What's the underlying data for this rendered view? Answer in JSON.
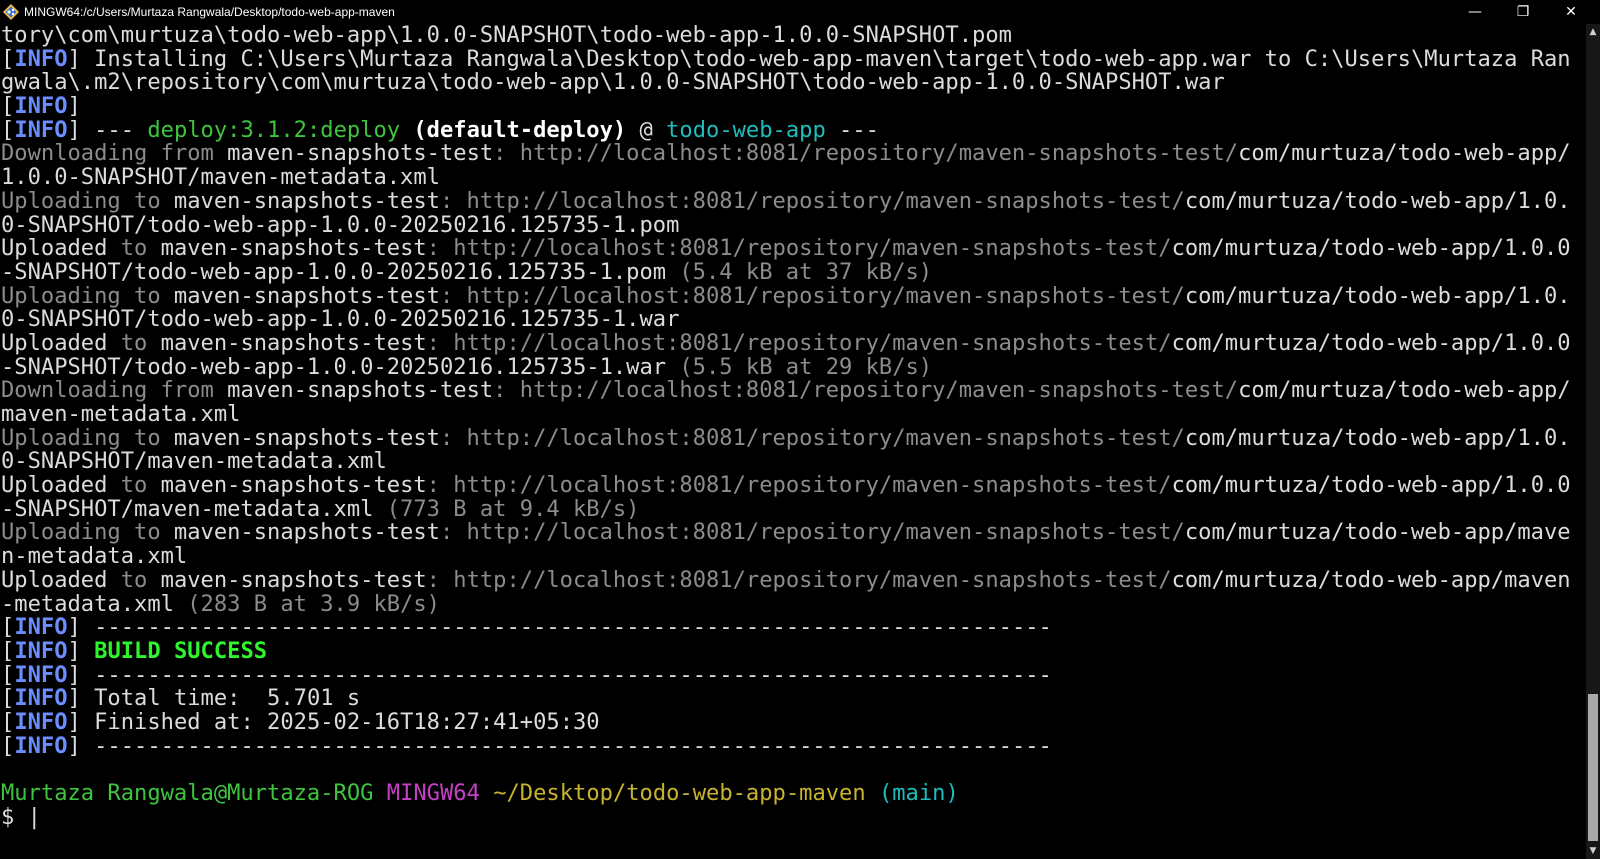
{
  "window": {
    "title": "MINGW64:/c/Users/Murtaza Rangwala/Desktop/todo-web-app-maven",
    "icon": "git-bash-icon",
    "minimize_glyph": "—",
    "maximize_glyph": "❐",
    "close_glyph": "✕"
  },
  "lines": [
    [
      {
        "t": "tory\\com\\murtuza\\todo-web-app\\1.0.0-SNAPSHOT\\todo-web-app-1.0.0-SNAPSHOT.pom",
        "c": "w"
      }
    ],
    [
      {
        "t": "[",
        "c": "w"
      },
      {
        "t": "INFO",
        "c": "b"
      },
      {
        "t": "] Installing C:\\Users\\Murtaza Rangwala\\Desktop\\todo-web-app-maven\\target\\todo-web-app.war to C:\\Users\\Murtaza Ran",
        "c": "w"
      }
    ],
    [
      {
        "t": "gwala\\.m2\\repository\\com\\murtuza\\todo-web-app\\1.0.0-SNAPSHOT\\todo-web-app-1.0.0-SNAPSHOT.war",
        "c": "w"
      }
    ],
    [
      {
        "t": "[",
        "c": "w"
      },
      {
        "t": "INFO",
        "c": "b"
      },
      {
        "t": "]",
        "c": "w"
      }
    ],
    [
      {
        "t": "[",
        "c": "w"
      },
      {
        "t": "INFO",
        "c": "b"
      },
      {
        "t": "] --- ",
        "c": "w"
      },
      {
        "t": "deploy:3.1.2:deploy",
        "c": "grn"
      },
      {
        "t": " (default-deploy)",
        "c": "bw"
      },
      {
        "t": " @ ",
        "c": "w"
      },
      {
        "t": "todo-web-app",
        "c": "cy"
      },
      {
        "t": " ---",
        "c": "w"
      }
    ],
    [
      {
        "t": "Downloading from ",
        "c": "g"
      },
      {
        "t": "maven-snapshots-test",
        "c": "w"
      },
      {
        "t": ": http://localhost:8081/repository/maven-snapshots-test/",
        "c": "g"
      },
      {
        "t": "com/murtuza/todo-web-app/",
        "c": "w"
      }
    ],
    [
      {
        "t": "1.0.0-SNAPSHOT/maven-metadata.xml",
        "c": "w"
      }
    ],
    [
      {
        "t": "Uploading to ",
        "c": "g"
      },
      {
        "t": "maven-snapshots-test",
        "c": "w"
      },
      {
        "t": ": http://localhost:8081/repository/maven-snapshots-test/",
        "c": "g"
      },
      {
        "t": "com/murtuza/todo-web-app/1.0.",
        "c": "w"
      }
    ],
    [
      {
        "t": "0-SNAPSHOT/todo-web-app-1.0.0-20250216.125735-1.pom",
        "c": "w"
      }
    ],
    [
      {
        "t": "Uploaded",
        "c": "w"
      },
      {
        "t": " to ",
        "c": "g"
      },
      {
        "t": "maven-snapshots-test",
        "c": "w"
      },
      {
        "t": ": http://localhost:8081/repository/maven-snapshots-test/",
        "c": "g"
      },
      {
        "t": "com/murtuza/todo-web-app/1.0.0",
        "c": "w"
      }
    ],
    [
      {
        "t": "-SNAPSHOT/todo-web-app-1.0.0-20250216.125735-1.pom",
        "c": "w"
      },
      {
        "t": " (5.4 kB at 37 kB/s)",
        "c": "g"
      }
    ],
    [
      {
        "t": "Uploading to ",
        "c": "g"
      },
      {
        "t": "maven-snapshots-test",
        "c": "w"
      },
      {
        "t": ": http://localhost:8081/repository/maven-snapshots-test/",
        "c": "g"
      },
      {
        "t": "com/murtuza/todo-web-app/1.0.",
        "c": "w"
      }
    ],
    [
      {
        "t": "0-SNAPSHOT/todo-web-app-1.0.0-20250216.125735-1.war",
        "c": "w"
      }
    ],
    [
      {
        "t": "Uploaded",
        "c": "w"
      },
      {
        "t": " to ",
        "c": "g"
      },
      {
        "t": "maven-snapshots-test",
        "c": "w"
      },
      {
        "t": ": http://localhost:8081/repository/maven-snapshots-test/",
        "c": "g"
      },
      {
        "t": "com/murtuza/todo-web-app/1.0.0",
        "c": "w"
      }
    ],
    [
      {
        "t": "-SNAPSHOT/todo-web-app-1.0.0-20250216.125735-1.war",
        "c": "w"
      },
      {
        "t": " (5.5 kB at 29 kB/s)",
        "c": "g"
      }
    ],
    [
      {
        "t": "Downloading from ",
        "c": "g"
      },
      {
        "t": "maven-snapshots-test",
        "c": "w"
      },
      {
        "t": ": http://localhost:8081/repository/maven-snapshots-test/",
        "c": "g"
      },
      {
        "t": "com/murtuza/todo-web-app/",
        "c": "w"
      }
    ],
    [
      {
        "t": "maven-metadata.xml",
        "c": "w"
      }
    ],
    [
      {
        "t": "Uploading to ",
        "c": "g"
      },
      {
        "t": "maven-snapshots-test",
        "c": "w"
      },
      {
        "t": ": http://localhost:8081/repository/maven-snapshots-test/",
        "c": "g"
      },
      {
        "t": "com/murtuza/todo-web-app/1.0.",
        "c": "w"
      }
    ],
    [
      {
        "t": "0-SNAPSHOT/maven-metadata.xml",
        "c": "w"
      }
    ],
    [
      {
        "t": "Uploaded",
        "c": "w"
      },
      {
        "t": " to ",
        "c": "g"
      },
      {
        "t": "maven-snapshots-test",
        "c": "w"
      },
      {
        "t": ": http://localhost:8081/repository/maven-snapshots-test/",
        "c": "g"
      },
      {
        "t": "com/murtuza/todo-web-app/1.0.0",
        "c": "w"
      }
    ],
    [
      {
        "t": "-SNAPSHOT/maven-metadata.xml",
        "c": "w"
      },
      {
        "t": " (773 B at 9.4 kB/s)",
        "c": "g"
      }
    ],
    [
      {
        "t": "Uploading to ",
        "c": "g"
      },
      {
        "t": "maven-snapshots-test",
        "c": "w"
      },
      {
        "t": ": http://localhost:8081/repository/maven-snapshots-test/",
        "c": "g"
      },
      {
        "t": "com/murtuza/todo-web-app/mave",
        "c": "w"
      }
    ],
    [
      {
        "t": "n-metadata.xml",
        "c": "w"
      }
    ],
    [
      {
        "t": "Uploaded",
        "c": "w"
      },
      {
        "t": " to ",
        "c": "g"
      },
      {
        "t": "maven-snapshots-test",
        "c": "w"
      },
      {
        "t": ": http://localhost:8081/repository/maven-snapshots-test/",
        "c": "g"
      },
      {
        "t": "com/murtuza/todo-web-app/maven",
        "c": "w"
      }
    ],
    [
      {
        "t": "-metadata.xml",
        "c": "w"
      },
      {
        "t": " (283 B at 3.9 kB/s)",
        "c": "g"
      }
    ],
    [
      {
        "t": "[",
        "c": "w"
      },
      {
        "t": "INFO",
        "c": "b"
      },
      {
        "t": "] ------------------------------------------------------------------------",
        "c": "w"
      }
    ],
    [
      {
        "t": "[",
        "c": "w"
      },
      {
        "t": "INFO",
        "c": "b"
      },
      {
        "t": "] ",
        "c": "w"
      },
      {
        "t": "BUILD SUCCESS",
        "c": "bgrn"
      }
    ],
    [
      {
        "t": "[",
        "c": "w"
      },
      {
        "t": "INFO",
        "c": "b"
      },
      {
        "t": "] ------------------------------------------------------------------------",
        "c": "w"
      }
    ],
    [
      {
        "t": "[",
        "c": "w"
      },
      {
        "t": "INFO",
        "c": "b"
      },
      {
        "t": "] Total time:  5.701 s",
        "c": "w"
      }
    ],
    [
      {
        "t": "[",
        "c": "w"
      },
      {
        "t": "INFO",
        "c": "b"
      },
      {
        "t": "] Finished at: 2025-02-16T18:27:41+05:30",
        "c": "w"
      }
    ],
    [
      {
        "t": "[",
        "c": "w"
      },
      {
        "t": "INFO",
        "c": "b"
      },
      {
        "t": "] ------------------------------------------------------------------------",
        "c": "w"
      }
    ],
    [],
    [
      {
        "t": "Murtaza Rangwala@Murtaza-ROG",
        "c": "grn"
      },
      {
        "t": " ",
        "c": "w"
      },
      {
        "t": "MINGW64",
        "c": "mag"
      },
      {
        "t": " ",
        "c": "w"
      },
      {
        "t": "~/Desktop/todo-web-app-maven",
        "c": "ylw"
      },
      {
        "t": " (main)",
        "c": "cy"
      }
    ]
  ],
  "prompt": {
    "symbol": "$ ",
    "cursor": "|"
  },
  "scrollbar": {
    "up_arrow": "▲",
    "down_arrow": "▼"
  },
  "colors": {
    "background": "#000000",
    "info_blue": "#6b8dff",
    "success_green": "#2ef52e",
    "prompt_green": "#3ec43e",
    "prompt_magenta": "#c640c6",
    "prompt_yellow": "#c9b32e",
    "prompt_cyan": "#1fbcbc"
  }
}
